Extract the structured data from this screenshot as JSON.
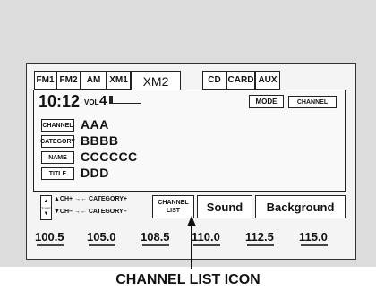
{
  "tabs": [
    {
      "label": "FM1"
    },
    {
      "label": "FM2"
    },
    {
      "label": "AM"
    },
    {
      "label": "XM1"
    },
    {
      "label": "XM2",
      "selected": true
    },
    {
      "label": "CD"
    },
    {
      "label": "CARD"
    },
    {
      "label": "AUX"
    }
  ],
  "status": {
    "time": "10:12",
    "vol_label": "VOL",
    "vol_value": "4",
    "mode_label": "MODE",
    "mode_value": "CHANNEL"
  },
  "info_rows": [
    {
      "label": "CHANNEL",
      "value": "AAA"
    },
    {
      "label": "CATEGORY",
      "value": "BBBB"
    },
    {
      "label": "NAME",
      "value": "CCCCCC"
    },
    {
      "label": "TITLE",
      "value": "DDD"
    }
  ],
  "controls": {
    "tune_label": "TUNE",
    "ch_up": "▲CH+ →← CATEGORY+",
    "ch_down": "▼CH– →← CATEGORY–",
    "channel_list_line1": "CHANNEL",
    "channel_list_line2": "LIST",
    "sound": "Sound",
    "background": "Background"
  },
  "presets": [
    "100.5",
    "105.0",
    "108.5",
    "110.0",
    "112.5",
    "115.0"
  ],
  "callout": "CHANNEL LIST ICON"
}
